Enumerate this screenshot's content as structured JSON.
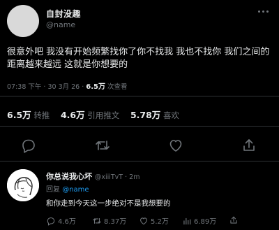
{
  "tweet": {
    "author_name": "自封没趣",
    "author_handle": "@name",
    "text": "很意外吧 我没有开始频繁找你了你不找我 我也不找你 我们之间的距离越来越远 这就是你想要的",
    "time": "07:38 下午 · 30 3月 26 · ",
    "views_count": "6.5万",
    "views_label": " 次查看"
  },
  "stats": {
    "retweets": "6.5万",
    "retweets_label": "转推",
    "quotes": "4.6万",
    "quotes_label": "引用推文",
    "likes": "5.78万",
    "likes_label": "喜欢"
  },
  "actions": [
    "reply-icon",
    "retweet-icon",
    "like-icon",
    "share-icon"
  ],
  "reply": {
    "author_name": "你总说我心坏",
    "author_handle": "@xiiiTvT · 2m",
    "replying_prefix": "回复 ",
    "replying_to": "@name",
    "text": "和你走到今天这一步绝对不是我想要的",
    "reply_count": "4.6万",
    "retweet_count": "8.37万",
    "like_count": "5.2万",
    "view_count": "6.89万"
  },
  "colors": {
    "background": "#000000",
    "text": "#e7e9ea",
    "muted": "#71767b",
    "accent": "#1d9bf0"
  }
}
